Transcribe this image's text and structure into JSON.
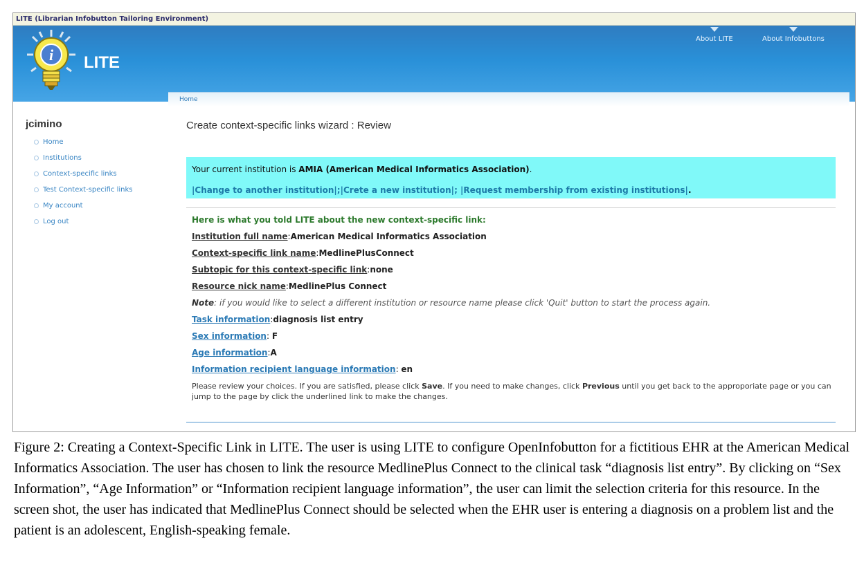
{
  "window": {
    "title": "LITE (Librarian Infobutton Tailoring Environment)"
  },
  "header": {
    "site_name": "LITE",
    "nav": [
      {
        "label": "About LITE"
      },
      {
        "label": "About Infobuttons"
      }
    ]
  },
  "breadcrumb": "Home",
  "sidebar": {
    "username": "jcimino",
    "items": [
      {
        "label": "Home"
      },
      {
        "label": "Institutions"
      },
      {
        "label": "Context-specific links"
      },
      {
        "label": "Test Context-specific links"
      },
      {
        "label": "My account"
      },
      {
        "label": "Log out"
      }
    ]
  },
  "main": {
    "title": "Create context-specific links wizard : Review",
    "institution": {
      "prefix": "Your current institution is ",
      "name": "AMIA (American Medical Informatics Association)",
      "suffix": ".",
      "links": [
        "|Change to another institution|",
        ";|Crete a new institution|",
        "; |Request membership from existing institutions|"
      ],
      "links_end": "."
    },
    "review": {
      "intro": "Here is what you told LITE about the new context-specific link:",
      "fields": [
        {
          "label": "Institution full name",
          "sep": ":",
          "value": "American Medical Informatics Association"
        },
        {
          "label": "Context-specific link name",
          "sep": ":",
          "value": "MedlinePlusConnect"
        },
        {
          "label": "Subtopic for this context-specific link",
          "sep": ":",
          "value": "none"
        },
        {
          "label": "Resource nick name",
          "sep": ":",
          "value": "MedlinePlus Connect"
        }
      ],
      "note_label": "Note",
      "note_text": ": if you would like to select a different institution or resource name please click 'Quit' button to start the process again.",
      "link_fields": [
        {
          "label": "Task information",
          "sep": ":",
          "value": "diagnosis list entry"
        },
        {
          "label": "Sex information",
          "sep": ": ",
          "value": "F"
        },
        {
          "label": "Age information",
          "sep": ":",
          "value": "A"
        },
        {
          "label": "Information recipient language information",
          "sep": ": ",
          "value": "en"
        }
      ],
      "help_1": "Please review your choices. If you are satisfied, please click ",
      "help_save": "Save",
      "help_2": ". If you need to make changes, click ",
      "help_previous": "Previous",
      "help_3": " until you get back to the approporiate page or you can jump to the page by click the underlined link to make the changes."
    }
  },
  "caption": "Figure 2:  Creating a Context-Specific Link in LITE.  The user is using LITE to configure OpenInfobutton for a fictitious EHR at the American Medical Informatics Association.  The user has chosen to link the resource MedlinePlus Connect to the clinical task “diagnosis list entry”.  By clicking on “Sex Information”, “Age Information” or “Information recipient language information”, the user can limit the selection criteria for this resource. In the screen shot, the user has indicated that MedlinePlus Connect should be selected when the EHR user is entering a diagnosis on a problem list and the patient is an adolescent, English-speaking female."
}
